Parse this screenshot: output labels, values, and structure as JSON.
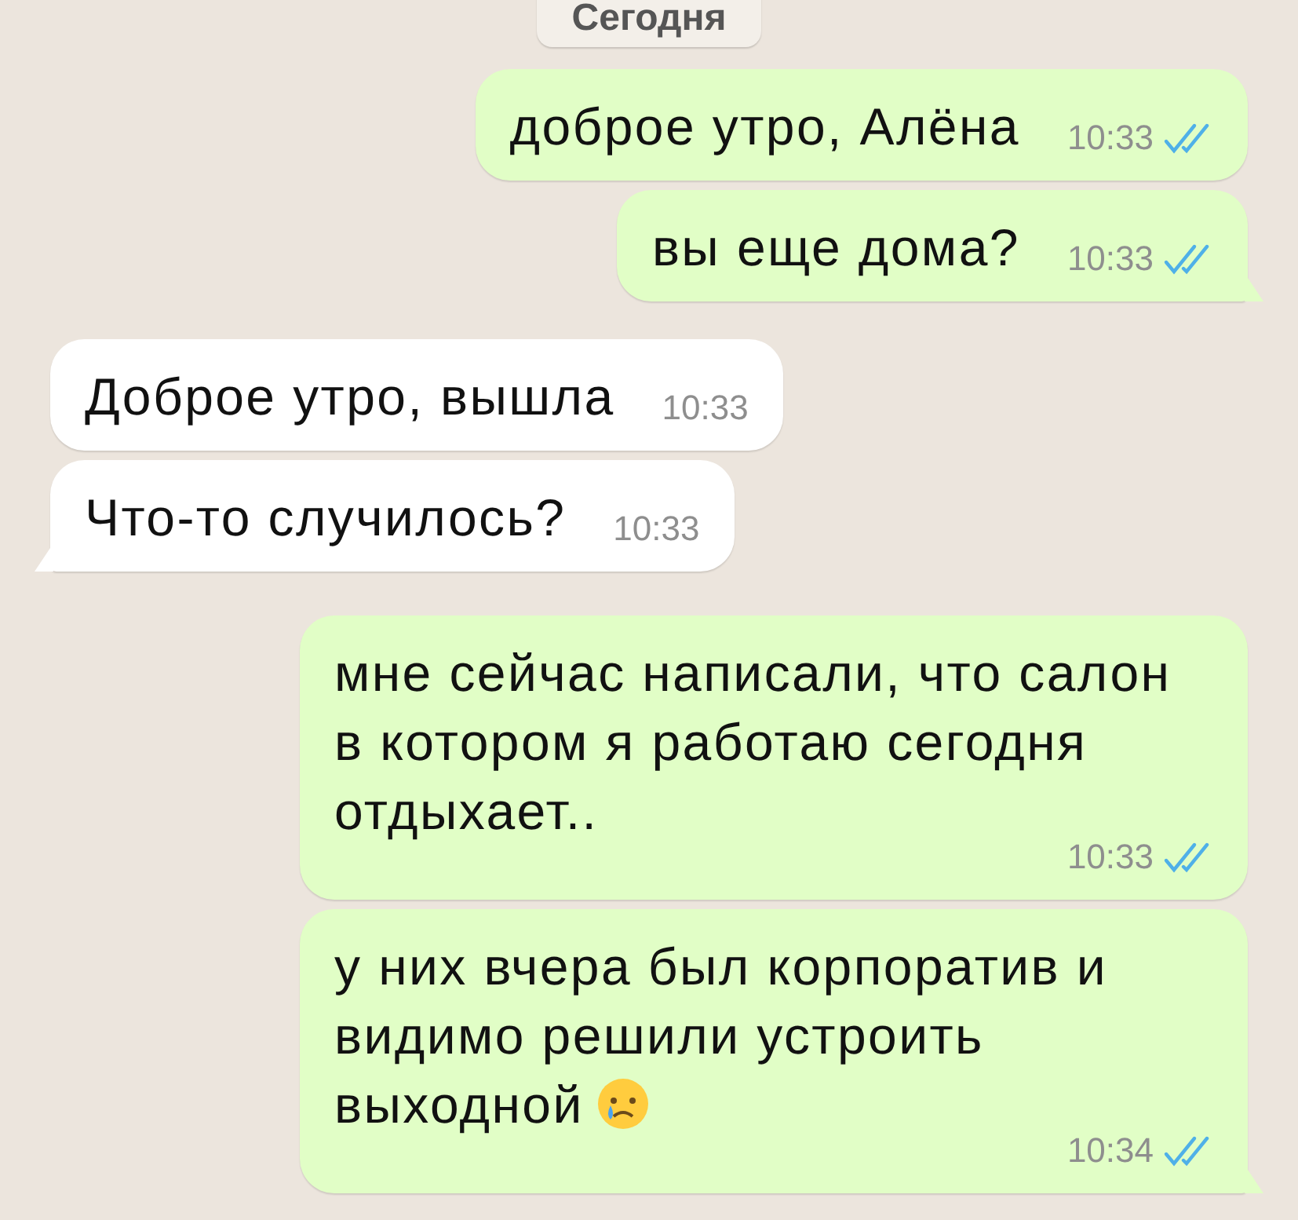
{
  "date_label": "Сегодня",
  "messages": [
    {
      "outgoing": true,
      "text": "доброе утро, Алёна",
      "time": "10:33",
      "read": true,
      "tail": false
    },
    {
      "outgoing": true,
      "text": "вы еще дома?",
      "time": "10:33",
      "read": true,
      "tail": true
    },
    {
      "outgoing": false,
      "text": "Доброе утро, вышла",
      "time": "10:33",
      "tail": false
    },
    {
      "outgoing": false,
      "text": "Что-то случилось?",
      "time": "10:33",
      "tail": true
    },
    {
      "outgoing": true,
      "text": "мне сейчас написали, что салон в котором я работаю сегодня отдыхает..",
      "time": "10:33",
      "read": true,
      "tail": false
    },
    {
      "outgoing": true,
      "text": "у них вчера был корпоратив и видимо решили устроить выходной",
      "crying_emoji": true,
      "time": "10:34",
      "read": true,
      "tail": true
    }
  ]
}
